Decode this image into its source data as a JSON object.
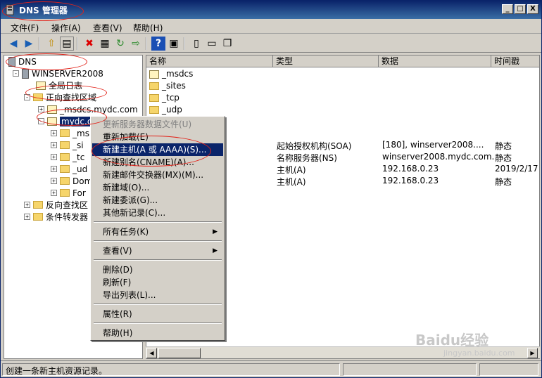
{
  "window": {
    "title": "DNS 管理器",
    "min": "_",
    "max": "□",
    "close": "X"
  },
  "menu": [
    "文件(F)",
    "操作(A)",
    "查看(V)",
    "帮助(H)"
  ],
  "tree": {
    "root": "DNS",
    "server": "WINSERVER2008",
    "global_log": "全局日志",
    "forward_zone": "正向查找区域",
    "msdcs_zone": "_msdcs.mydc.com",
    "mydc_zone": "mydc.co",
    "sub_items": [
      "_ms",
      "_si",
      "_tc",
      "_ud",
      "Dom",
      "For"
    ],
    "reverse_zone": "反向查找区",
    "conditional_forwarders": "条件转发器"
  },
  "list": {
    "columns": [
      "名称",
      "类型",
      "数据",
      "时间戳"
    ],
    "folders": [
      "_msdcs",
      "_sites",
      "_tcp",
      "_udp"
    ],
    "records": [
      {
        "name": ")",
        "type": "起始授权机构(SOA)",
        "data": "[180], winserver2008....",
        "time": "静态"
      },
      {
        "name": ")",
        "type": "名称服务器(NS)",
        "data": "winserver2008.mydc.com.",
        "time": "静态"
      },
      {
        "name": ")",
        "type": "主机(A)",
        "data": "192.168.0.23",
        "time": "2019/2/17"
      },
      {
        "name": "",
        "type": "主机(A)",
        "data": "192.168.0.23",
        "time": "静态"
      }
    ]
  },
  "context_menu": {
    "items": [
      {
        "label": "更新服务器数据文件(U)",
        "disabled": true
      },
      {
        "label": "重新加载(E)"
      },
      {
        "label": "新建主机(A 或 AAAA)(S)...",
        "highlighted": true
      },
      {
        "label": "新建别名(CNAME)(A)..."
      },
      {
        "label": "新建邮件交换器(MX)(M)..."
      },
      {
        "label": "新建域(O)..."
      },
      {
        "label": "新建委派(G)..."
      },
      {
        "label": "其他新记录(C)..."
      },
      {
        "label": "所有任务(K)",
        "submenu": true
      },
      {
        "label": "查看(V)",
        "submenu": true
      },
      {
        "label": "删除(D)"
      },
      {
        "label": "刷新(F)"
      },
      {
        "label": "导出列表(L)..."
      },
      {
        "label": "属性(R)"
      },
      {
        "label": "帮助(H)"
      }
    ]
  },
  "status": "创建一条新主机资源记录。",
  "watermark": {
    "brand": "Baidu经验",
    "url": "jingyan.baidu.com"
  },
  "colors": {
    "title_bar": "#0a246a",
    "highlight": "#0a246a",
    "annotation": "#e2231a",
    "folder": "#f6d56b"
  }
}
